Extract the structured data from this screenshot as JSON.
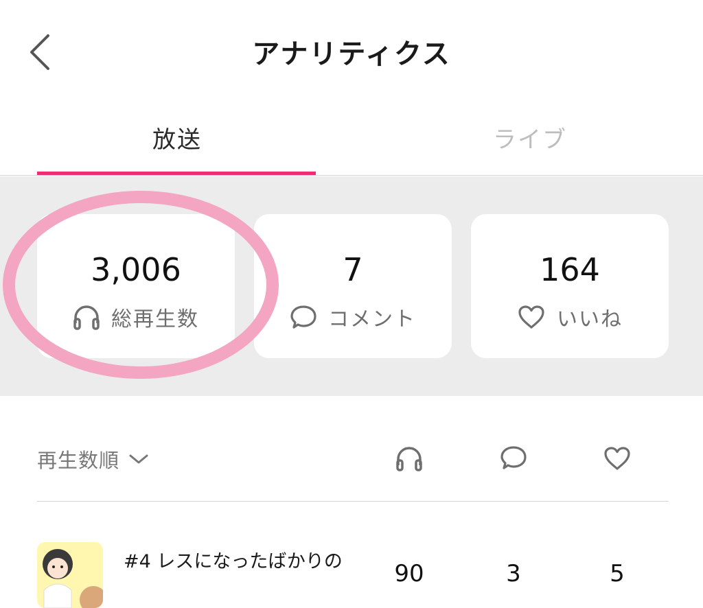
{
  "header": {
    "title": "アナリティクス",
    "back_icon": "chevron-left-icon"
  },
  "tabs": [
    {
      "label": "放送",
      "active": true
    },
    {
      "label": "ライブ",
      "active": false
    }
  ],
  "colors": {
    "accent": "#ec2f74",
    "highlight": "#f3a5c2",
    "band": "#ececec"
  },
  "stats": [
    {
      "value": "3,006",
      "label": "総再生数",
      "icon": "headphones-icon"
    },
    {
      "value": "7",
      "label": "コメント",
      "icon": "comment-icon"
    },
    {
      "value": "164",
      "label": "いいね",
      "icon": "heart-icon"
    }
  ],
  "sort": {
    "label": "再生数順",
    "icon": "chevron-down-icon"
  },
  "columns": [
    "headphones-icon",
    "comment-icon",
    "heart-icon"
  ],
  "episodes": [
    {
      "title": "#4 レスになったばかりの",
      "plays": "90",
      "comments": "3",
      "likes": "5"
    }
  ]
}
